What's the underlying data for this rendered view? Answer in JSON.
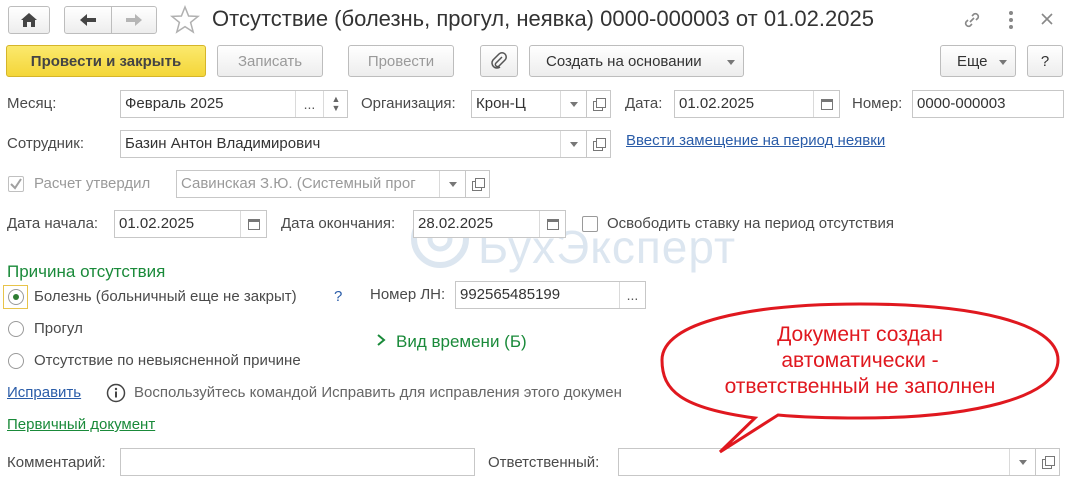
{
  "header": {
    "title": "Отсутствие (болезнь, прогул, неявка) 0000-000003 от 01.02.2025",
    "icons": [
      "home-icon",
      "arrow-left-icon",
      "arrow-right-icon",
      "star-icon",
      "link-icon",
      "more-vert-icon",
      "close-icon"
    ]
  },
  "toolbar": {
    "post_close": "Провести и закрыть",
    "save": "Записать",
    "post": "Провести",
    "create_based": "Создать на основании",
    "more": "Еще",
    "help": "?"
  },
  "form": {
    "month_label": "Месяц:",
    "month_value": "Февраль 2025",
    "org_label": "Организация:",
    "org_value": "Крон-Ц",
    "date_label": "Дата:",
    "date_value": "01.02.2025",
    "number_label": "Номер:",
    "number_value": "0000-000003",
    "employee_label": "Сотрудник:",
    "employee_value": "Базин Антон Владимирович",
    "replacement_link": "Ввести замещение на период неявки",
    "approved_label": "Расчет утвердил",
    "approver_value": "Савинская З.Ю. (Системный прог",
    "start_label": "Дата начала:",
    "start_value": "01.02.2025",
    "end_label": "Дата окончания:",
    "end_value": "28.02.2025",
    "release_label": "Освободить ставку на период отсутствия"
  },
  "reason": {
    "title": "Причина отсутствия",
    "options": [
      {
        "label": "Болезнь (больничный еще не закрыт)",
        "selected": true
      },
      {
        "label": "Прогул",
        "selected": false
      },
      {
        "label": "Отсутствие по невыясненной причине",
        "selected": false
      }
    ],
    "help_mark": "?",
    "sick_number_label": "Номер ЛН:",
    "sick_number_value": "992565485199",
    "time_type": "Вид времени (Б)"
  },
  "fix": {
    "link": "Исправить",
    "hint": "Воспользуйтесь командой Исправить для исправления этого докумен"
  },
  "primary_doc_link": "Первичный документ",
  "bottom": {
    "comment_label": "Комментарий:",
    "responsible_label": "Ответственный:"
  },
  "callout": {
    "line1": "Документ создан",
    "line2": "автоматически -",
    "line3": "ответственный не заполнен"
  },
  "watermark": "БухЭксперт",
  "colors": {
    "primary": "#f4d639",
    "link": "#2a5ca8",
    "section": "#1a8a3a",
    "callout": "#e0181f"
  }
}
